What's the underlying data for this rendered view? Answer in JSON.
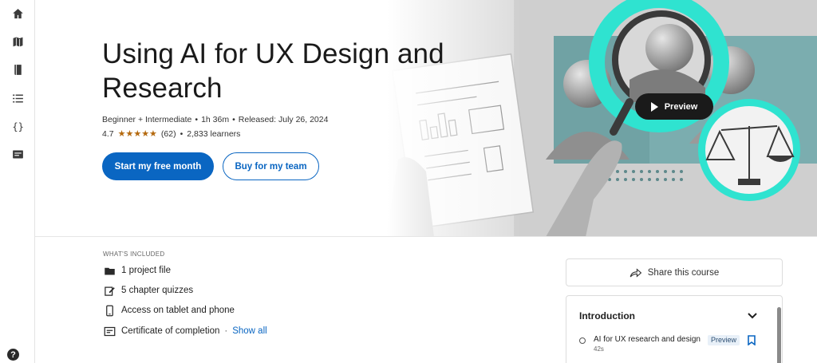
{
  "nav": {
    "items": [
      {
        "icon": "home-icon"
      },
      {
        "icon": "map-icon"
      },
      {
        "icon": "book-icon"
      },
      {
        "icon": "list-icon"
      },
      {
        "icon": "code-braces-icon"
      },
      {
        "icon": "certificate-icon"
      }
    ],
    "help_label": "?"
  },
  "course": {
    "title": "Using AI for UX Design and Research",
    "level": "Beginner + Intermediate",
    "duration": "1h 36m",
    "released": "Released: July 26, 2024",
    "rating": "4.7",
    "stars": "★★★★★",
    "rating_count": "(62)",
    "learners": "2,833 learners",
    "primary_cta": "Start my free month",
    "secondary_cta": "Buy for my team",
    "preview_label": "Preview"
  },
  "included": {
    "label": "WHAT'S INCLUDED",
    "items": [
      {
        "icon": "folder-icon",
        "text": "1 project file"
      },
      {
        "icon": "edit-quiz-icon",
        "text": "5 chapter quizzes"
      },
      {
        "icon": "phone-icon",
        "text": "Access on tablet and phone"
      },
      {
        "icon": "certificate-icon",
        "text": "Certificate of completion"
      }
    ],
    "separator": "·",
    "show_all": "Show all"
  },
  "sidebar": {
    "share_label": "Share this course",
    "toc": {
      "section": "Introduction",
      "items": [
        {
          "title": "AI for UX research and design",
          "duration": "42s",
          "badge": "Preview"
        }
      ]
    }
  },
  "colors": {
    "brand": "#0a66c2",
    "star": "#b4690e",
    "teal": "#2fb5b7"
  }
}
